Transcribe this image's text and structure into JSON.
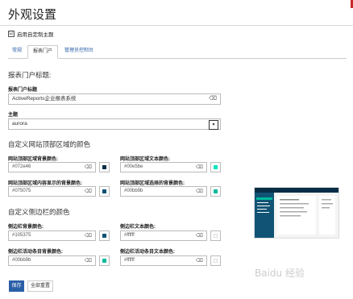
{
  "page": {
    "title": "外观设置"
  },
  "custom_theme": {
    "checkmark": "☑",
    "label": "启用自定制主题",
    "checked": true
  },
  "tabs": [
    {
      "label": "常规",
      "active": false
    },
    {
      "label": "报表门户",
      "active": true
    },
    {
      "label": "管理员控制台",
      "active": false
    }
  ],
  "portal_title_section": {
    "heading": "报表门户标题:",
    "title_label": "报表门户标题",
    "title_value": "ActiveReports企业报表系统",
    "theme_label": "主题",
    "theme_value": "aurora"
  },
  "site_header_section": {
    "heading": "自定义网站顶部区域的颜色",
    "fields": [
      {
        "label": "网站顶部区域背景颜色:",
        "value": "#072e46",
        "swatch": "#072e46"
      },
      {
        "label": "网站顶部区域文本颜色:",
        "value": "#00e5be",
        "swatch": "#00e5be"
      },
      {
        "label": "网站顶部区域内容显示的背景颜色:",
        "value": "#075075",
        "swatch": "#075075"
      },
      {
        "label": "网站顶部区域选择的背景颜色:",
        "value": "#00bb9b",
        "swatch": "#00bb9b"
      }
    ]
  },
  "sidebar_section": {
    "heading": "自定义侧边栏的颜色",
    "fields": [
      {
        "label": "侧边栏背景颜色:",
        "value": "#105375",
        "swatch": "#105375"
      },
      {
        "label": "侧边栏文本颜色:",
        "value": "#ffffff",
        "swatch": "#ffffff"
      },
      {
        "label": "侧边栏活动条目背景颜色:",
        "value": "#00bb9b",
        "swatch": "#00bb9b"
      },
      {
        "label": "侧边栏活动条目文本颜色:",
        "value": "#ffffff",
        "swatch": "#ffffff"
      }
    ]
  },
  "icons": {
    "tag": "tag-icon",
    "chevron": "chevron-down-icon",
    "checkbox": "checkbox-icon"
  },
  "preview": {
    "colors": {
      "header": "#072e46",
      "sidebar": "#105375",
      "accent": "#00bb9b",
      "panel": "#ffffff"
    }
  },
  "buttons": {
    "save": "保存",
    "reset": "全部重置"
  },
  "watermark": "Baidu 经验"
}
